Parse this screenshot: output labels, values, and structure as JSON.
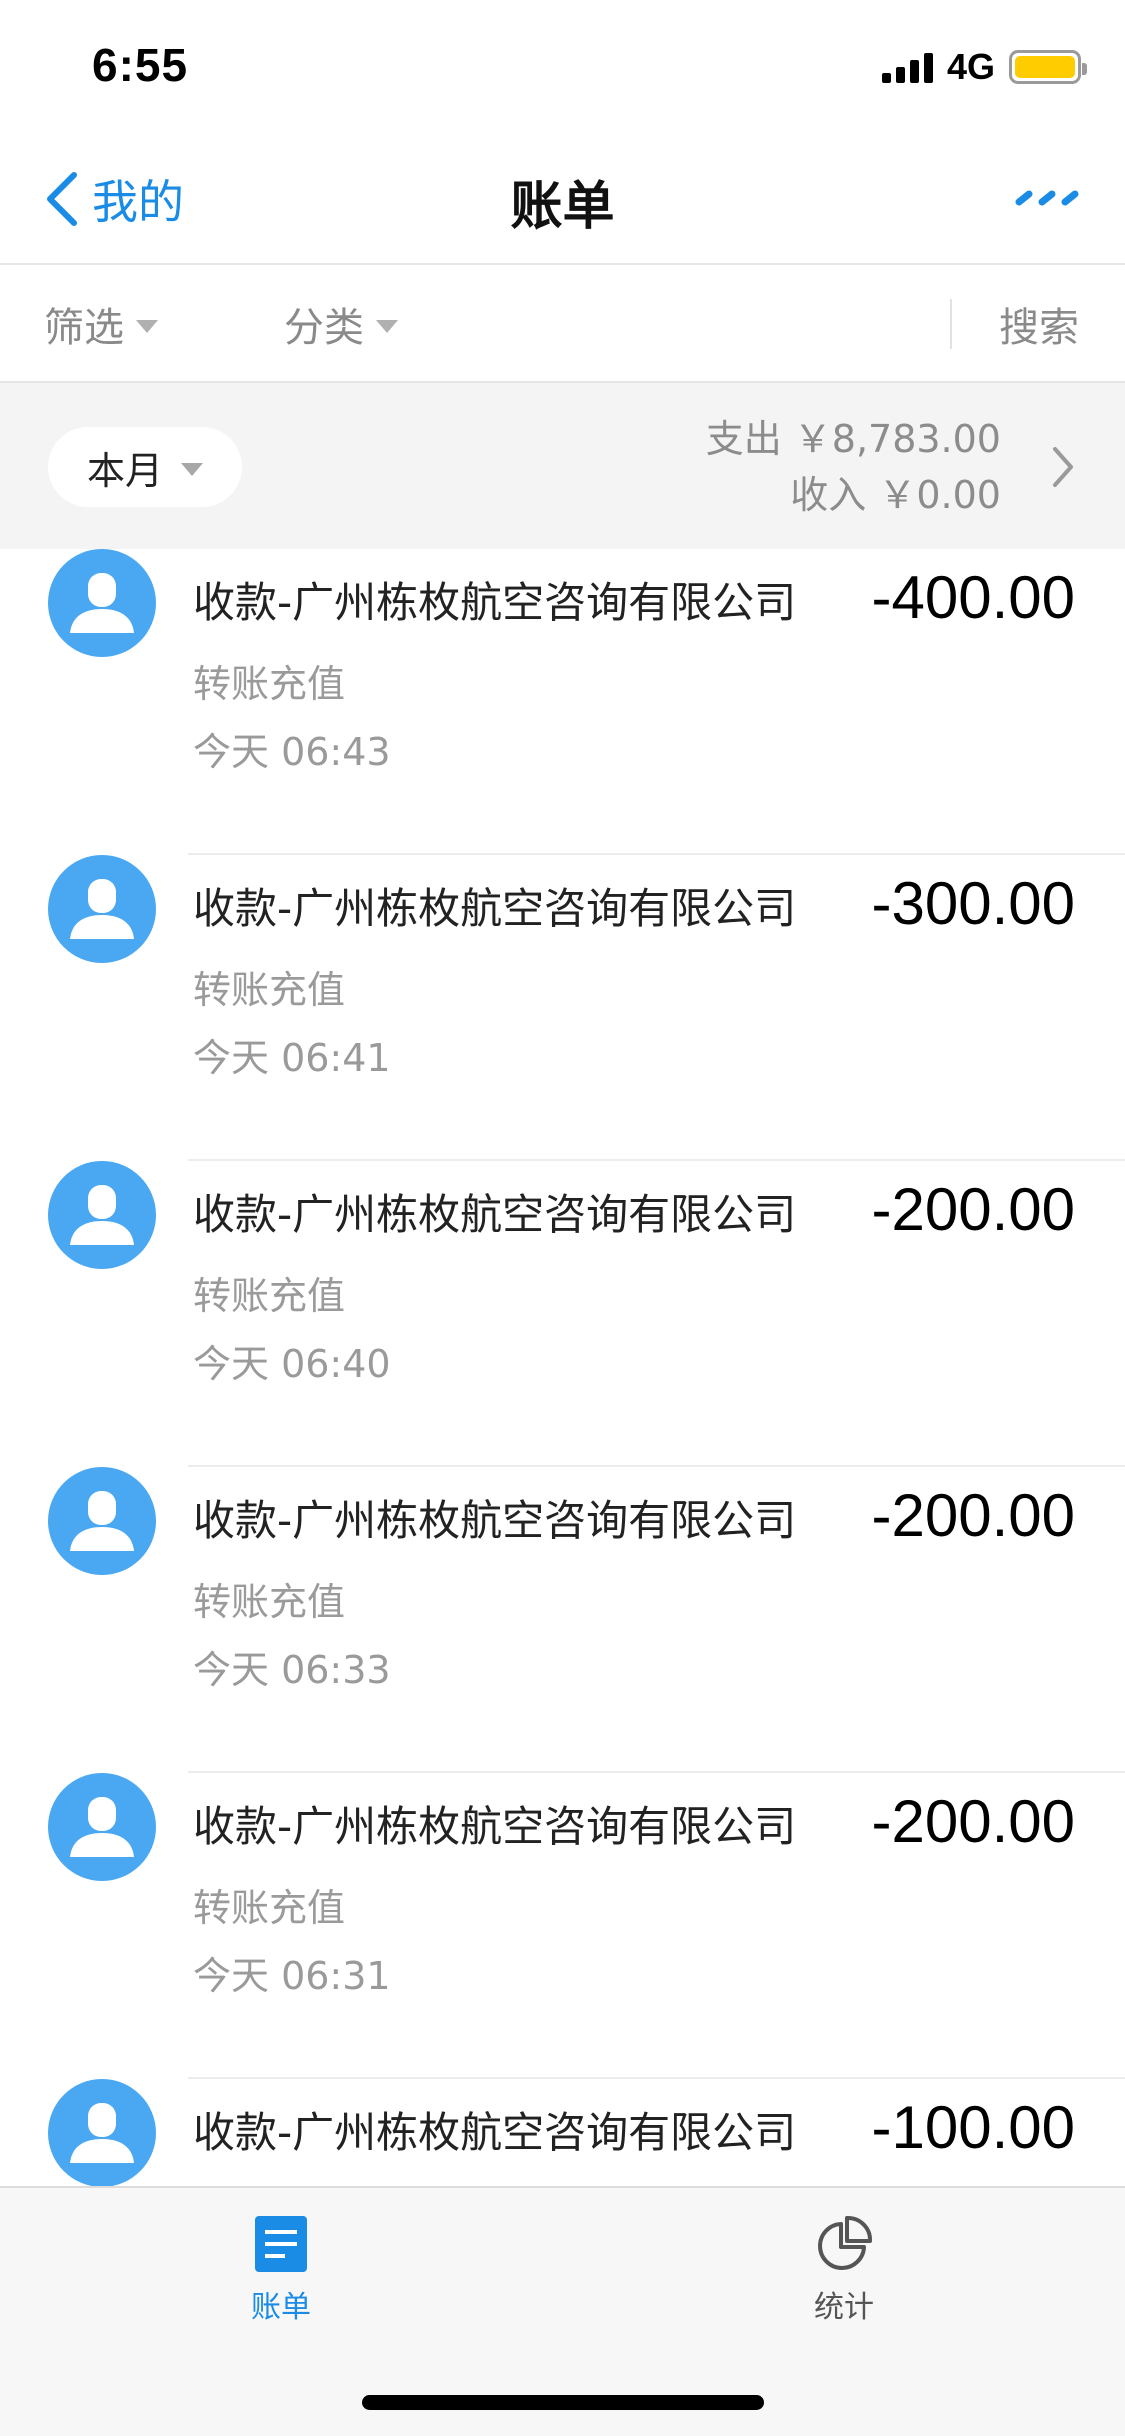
{
  "status_bar": {
    "time": "6:55",
    "network": "4G",
    "battery_color": "#ffcc00"
  },
  "nav": {
    "back_label": "我的",
    "title": "账单",
    "more_icon": "more-dashes-icon",
    "accent_color": "#1a8ce6"
  },
  "filters": {
    "filter_label": "筛选",
    "category_label": "分类",
    "search_label": "搜索"
  },
  "month": {
    "selected": "本月",
    "expense_text": "支出 ￥8,783.00",
    "income_text": "收入 ￥0.00"
  },
  "transactions": [
    {
      "title": "收款-广州栋枚航空咨询有限公司",
      "amount": "-400.00",
      "type": "转账充值",
      "time": "今天  06:43"
    },
    {
      "title": "收款-广州栋枚航空咨询有限公司",
      "amount": "-300.00",
      "type": "转账充值",
      "time": "今天  06:41"
    },
    {
      "title": "收款-广州栋枚航空咨询有限公司",
      "amount": "-200.00",
      "type": "转账充值",
      "time": "今天  06:40"
    },
    {
      "title": "收款-广州栋枚航空咨询有限公司",
      "amount": "-200.00",
      "type": "转账充值",
      "time": "今天  06:33"
    },
    {
      "title": "收款-广州栋枚航空咨询有限公司",
      "amount": "-200.00",
      "type": "转账充值",
      "time": "今天  06:31"
    },
    {
      "title": "收款-广州栋枚航空咨询有限公司",
      "amount": "-100.00",
      "type": "",
      "time": ""
    }
  ],
  "tabs": {
    "bill_label": "账单",
    "stats_label": "统计",
    "active_color": "#1a8ce6",
    "inactive_color": "#555555"
  }
}
